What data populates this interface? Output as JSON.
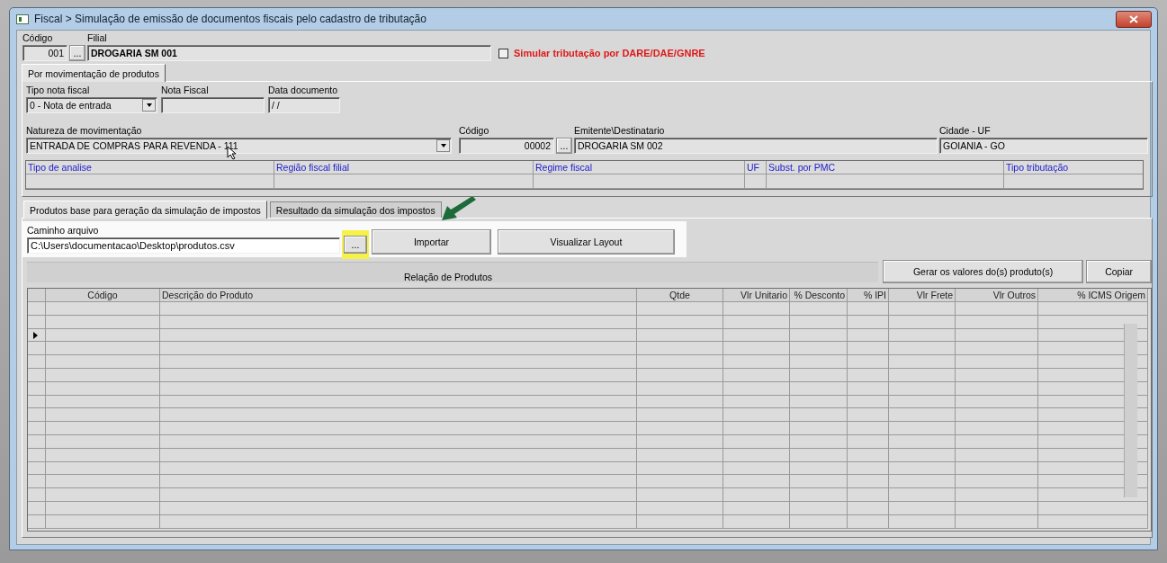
{
  "window": {
    "title": "Fiscal > Simulação de emissão de documentos fiscais pelo cadastro de tributação"
  },
  "header": {
    "codigo": {
      "label": "Código",
      "value": "001",
      "browse": "..."
    },
    "filial": {
      "label": "Filial",
      "value": "DROGARIA SM 001"
    },
    "simular": {
      "label": "Simular tributação por DARE/DAE/GNRE",
      "checked": false
    }
  },
  "top_tabs": [
    {
      "label": "Por movimentação de produtos",
      "selected": true
    }
  ],
  "field_rows": [
    [
      {
        "kind": "select",
        "label": "Tipo nota fiscal",
        "value": "0 - Nota de entrada"
      },
      {
        "kind": "text",
        "label": "Nota Fiscal"
      },
      {
        "kind": "text",
        "label": "Data documento",
        "value": "/ /"
      }
    ],
    [
      {
        "kind": "select",
        "label": "Natureza de movimentação",
        "value": "ENTRADA DE COMPRAS PARA REVENDA - 111"
      },
      {
        "kind": "lookup",
        "label": "Código",
        "value": "00002",
        "browse": "..."
      },
      {
        "kind": "text",
        "label": "Emitente\\Destinatario",
        "value": "DROGARIA SM 002"
      },
      {
        "kind": "text",
        "label": "Cidade - UF",
        "value": "GOIANIA - GO"
      }
    ]
  ],
  "analysis": {
    "columns": [
      "Tipo de analise",
      "Região fiscal filial",
      "Regime fiscal",
      "UF",
      "Subst. por PMC",
      "Tipo tributação"
    ]
  },
  "tabs": [
    {
      "label": "Produtos base para geração da simulação de impostos",
      "selected": true
    },
    {
      "label": "Resultado da simulação dos impostos",
      "selected": false
    }
  ],
  "file": {
    "label": "Caminho arquivo",
    "value": "C:\\Users\\documentacao\\Desktop\\produtos.csv",
    "browse": "...",
    "highlighted": true
  },
  "file_buttons": [
    "Importar",
    "Visualizar Layout"
  ],
  "products": {
    "title": "Relação de Produtos",
    "buttons": [
      "Gerar os valores do(s) produto(s)",
      "Copiar"
    ],
    "columns": [
      "Código",
      "Descrição do Produto",
      "Qtde",
      "Vlr Unitario",
      "% Desconto",
      "% IPI",
      "Vlr Frete",
      "Vlr Outros",
      "% ICMS Origem"
    ],
    "rows": [
      {
        "selected": false
      },
      {
        "selected": false
      },
      {
        "selected": true
      },
      {
        "selected": false
      },
      {
        "selected": false
      },
      {
        "selected": false
      },
      {
        "selected": false
      },
      {
        "selected": false
      },
      {
        "selected": false
      },
      {
        "selected": false
      },
      {
        "selected": false
      },
      {
        "selected": false
      },
      {
        "selected": false
      },
      {
        "selected": false
      },
      {
        "selected": false
      },
      {
        "selected": false
      },
      {
        "selected": false
      }
    ]
  }
}
